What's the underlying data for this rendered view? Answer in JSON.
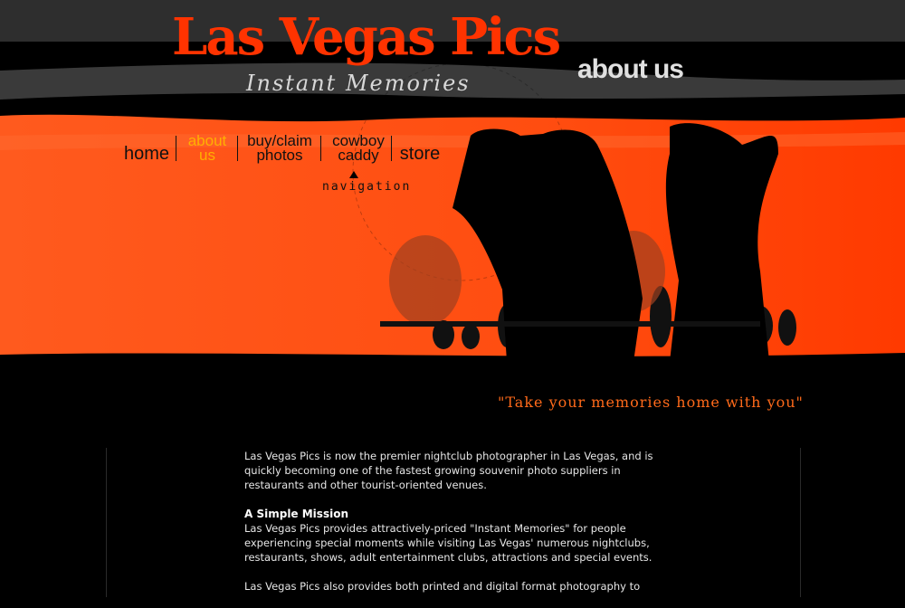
{
  "header": {
    "logo_title": "Las Vegas Pics",
    "logo_subtitle": "Instant Memories",
    "section_title": "about us"
  },
  "nav": {
    "items": [
      {
        "label_line1": "home",
        "label_line2": "",
        "active": false
      },
      {
        "label_line1": "about",
        "label_line2": "us",
        "active": true
      },
      {
        "label_line1": "buy/claim",
        "label_line2": "photos",
        "active": false
      },
      {
        "label_line1": "cowboy",
        "label_line2": "caddy",
        "active": false
      },
      {
        "label_line1": "store",
        "label_line2": "",
        "active": false
      }
    ],
    "caption": "navigation"
  },
  "tagline": "\"Take your memories home with you\"",
  "content": {
    "intro": "Las Vegas Pics is now the premier nightclub photographer in Las Vegas, and is quickly becoming one of the fastest growing souvenir photo suppliers in restaurants and other tourist-oriented venues.",
    "mission_heading": "A Simple Mission",
    "mission_text": "Las Vegas Pics provides attractively-priced \"Instant Memories\" for people experiencing special moments while visiting Las Vegas' numerous nightclubs, restaurants, shows, adult entertainment clubs, attractions and special events.",
    "more_text": "Las Vegas Pics also provides both printed and digital format photography to"
  },
  "colors": {
    "accent": "#ff3300",
    "hero_orange": "#ff5a1e",
    "nav_active": "#ffb000",
    "tagline": "#ff6a1a",
    "background": "#000000"
  }
}
